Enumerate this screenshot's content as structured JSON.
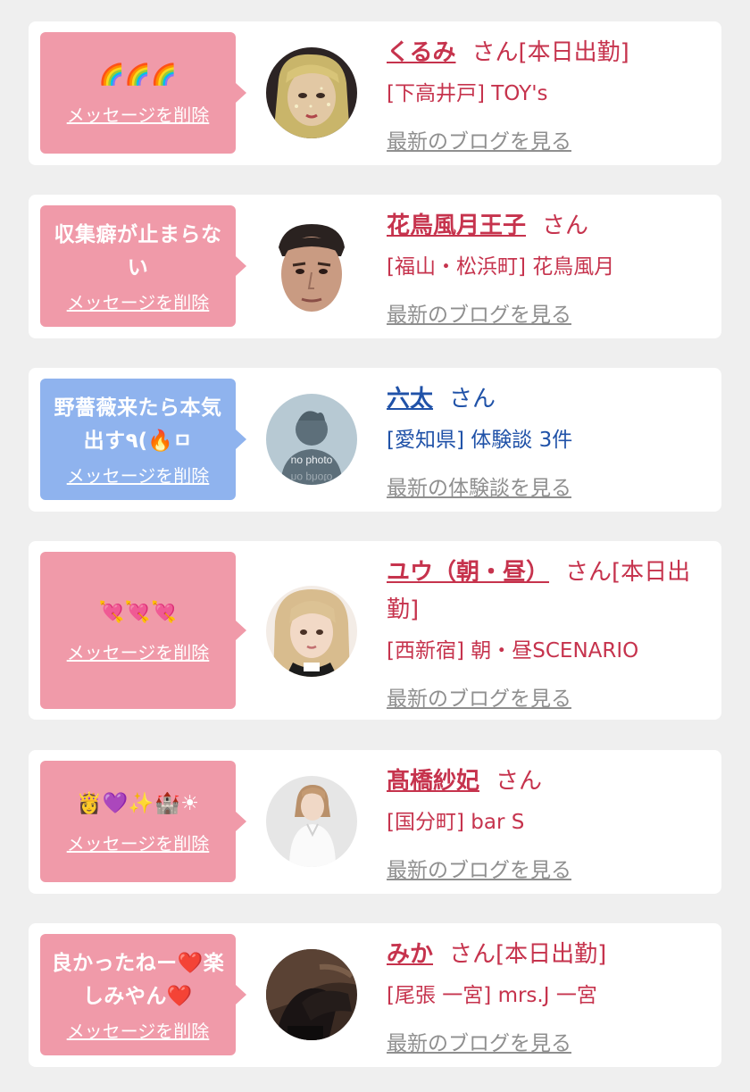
{
  "colors": {
    "pink_bubble": "#f09aa9",
    "blue_bubble": "#8fb3ee",
    "pink_text": "#c6334d",
    "blue_text": "#2052a8",
    "gray_link": "#8f8f8f"
  },
  "delete_label": "メッセージを削除",
  "messages": [
    {
      "bubble": "🌈🌈🌈",
      "bubble_color": "pink",
      "avatar": "photo-blonde-glitter",
      "name": "くるみ",
      "suffix": "さん[本日出勤]",
      "shop": "[下高井戸] TOY's",
      "link": "最新のブログを見る"
    },
    {
      "bubble": "収集癖が止まらない",
      "bubble_color": "pink",
      "avatar": "photo-man-face",
      "name": "花鳥風月王子",
      "suffix": "さん",
      "shop": "[福山・松浜町] 花鳥風月",
      "link": "最新のブログを見る"
    },
    {
      "bubble": "野薔薇来たら本気出す٩(🔥ㅁ",
      "bubble_color": "blue",
      "avatar": "no-photo-silhouette",
      "name": "六太",
      "suffix": "さん",
      "shop": "[愛知県] 体験談 3件",
      "link": "最新の体験談を見る"
    },
    {
      "bubble": "💘💘💘",
      "bubble_color": "pink",
      "avatar": "photo-blonde-woman",
      "name": "ユウ（朝・昼）",
      "suffix": "さん[本日出勤]",
      "shop": "[西新宿] 朝・昼SCENARIO",
      "link": "最新のブログを見る"
    },
    {
      "bubble": "👸💜✨🏰☀",
      "bubble_color": "pink",
      "avatar": "photo-woman-white",
      "name": "髙橋紗妃",
      "suffix": "さん",
      "shop": "[国分町] bar S",
      "link": "最新のブログを見る"
    },
    {
      "bubble": "良かったねー❤️楽しみやん❤️",
      "bubble_color": "pink",
      "avatar": "photo-legs-dark",
      "name": "みか",
      "suffix": "さん[本日出勤]",
      "shop": "[尾張 一宮] mrs.J 一宮",
      "link": "最新のブログを見る"
    }
  ]
}
